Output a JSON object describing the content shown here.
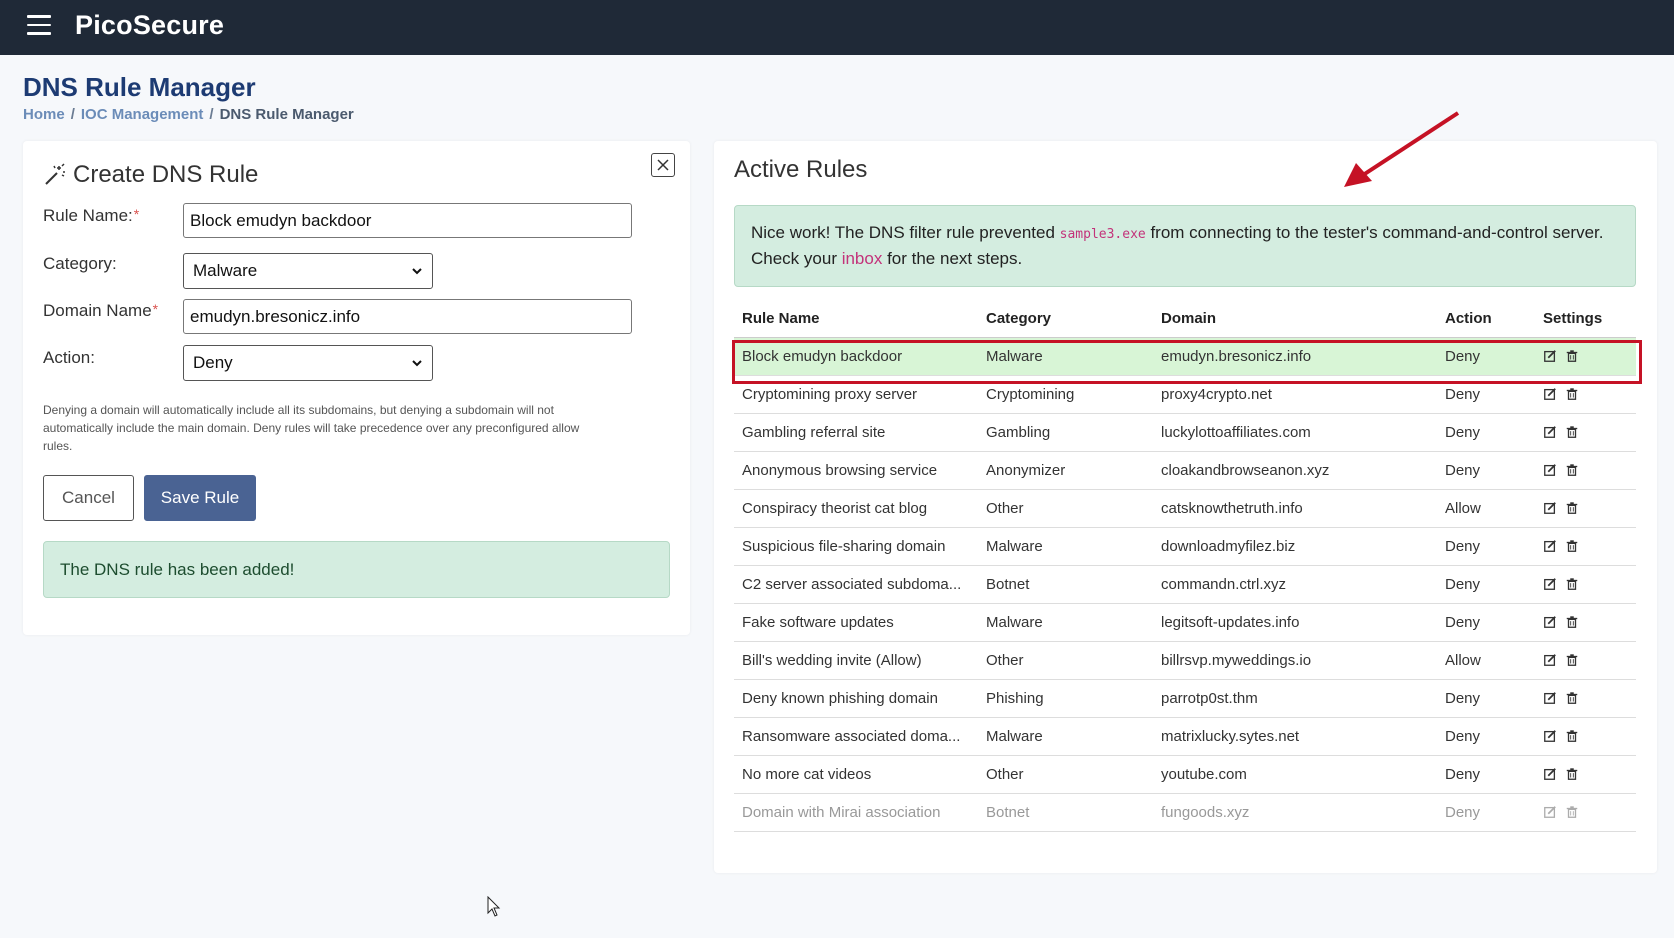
{
  "header": {
    "brand": "PicoSecure",
    "menu_icon": "hamburger-icon"
  },
  "page": {
    "title": "DNS Rule Manager",
    "breadcrumb": {
      "home": "Home",
      "ioc": "IOC Management",
      "current": "DNS Rule Manager",
      "sep": "/"
    }
  },
  "create_form": {
    "title": "Create DNS Rule",
    "rule_name_label": "Rule Name:",
    "rule_name_value": "Block emudyn backdoor",
    "category_label": "Category:",
    "category_value": "Malware",
    "domain_label": "Domain Name",
    "domain_value": "emudyn.bresonicz.info",
    "action_label": "Action:",
    "action_value": "Deny",
    "required_mark": "*",
    "help_text": "Denying a domain will automatically include all its subdomains, but denying a subdomain will not automatically include the main domain. Deny rules will take precedence over any preconfigured allow rules.",
    "cancel_label": "Cancel",
    "save_label": "Save Rule",
    "success_message": "The DNS rule has been added!"
  },
  "active_rules": {
    "title": "Active Rules",
    "alert": {
      "text_before": "Nice work! The DNS filter rule prevented ",
      "code": "sample3.exe",
      "text_middle": " from connecting to the tester's command-and-control server. Check your ",
      "link": "inbox",
      "text_after": " for the next steps."
    },
    "columns": {
      "name": "Rule Name",
      "category": "Category",
      "domain": "Domain",
      "action": "Action",
      "settings": "Settings"
    },
    "rows": [
      {
        "name": "Block emudyn backdoor",
        "category": "Malware",
        "domain": "emudyn.bresonicz.info",
        "action": "Deny"
      },
      {
        "name": "Cryptomining proxy server",
        "category": "Cryptomining",
        "domain": "proxy4crypto.net",
        "action": "Deny"
      },
      {
        "name": "Gambling referral site",
        "category": "Gambling",
        "domain": "luckylottoaffiliates.com",
        "action": "Deny"
      },
      {
        "name": "Anonymous browsing service",
        "category": "Anonymizer",
        "domain": "cloakandbrowseanon.xyz",
        "action": "Deny"
      },
      {
        "name": "Conspiracy theorist cat blog",
        "category": "Other",
        "domain": "catsknowthetruth.info",
        "action": "Allow"
      },
      {
        "name": "Suspicious file-sharing domain",
        "category": "Malware",
        "domain": "downloadmyfilez.biz",
        "action": "Deny"
      },
      {
        "name": "C2 server associated subdoma...",
        "category": "Botnet",
        "domain": "commandn.ctrl.xyz",
        "action": "Deny"
      },
      {
        "name": "Fake software updates",
        "category": "Malware",
        "domain": "legitsoft-updates.info",
        "action": "Deny"
      },
      {
        "name": "Bill's wedding invite (Allow)",
        "category": "Other",
        "domain": "billrsvp.myweddings.io",
        "action": "Allow"
      },
      {
        "name": "Deny known phishing domain",
        "category": "Phishing",
        "domain": "parrotp0st.thm",
        "action": "Deny"
      },
      {
        "name": "Ransomware associated doma...",
        "category": "Malware",
        "domain": "matrixlucky.sytes.net",
        "action": "Deny"
      },
      {
        "name": "No more cat videos",
        "category": "Other",
        "domain": "youtube.com",
        "action": "Deny"
      },
      {
        "name": "Domain with Mirai association",
        "category": "Botnet",
        "domain": "fungoods.xyz",
        "action": "Deny"
      }
    ]
  },
  "colors": {
    "topbar": "#1f2937",
    "title": "#1d3b73",
    "save_button": "#4a6393",
    "success_bg": "#d4ede0",
    "highlight_row": "#d8f5d6",
    "annotation_red": "#c51225",
    "link": "#c3337a"
  }
}
